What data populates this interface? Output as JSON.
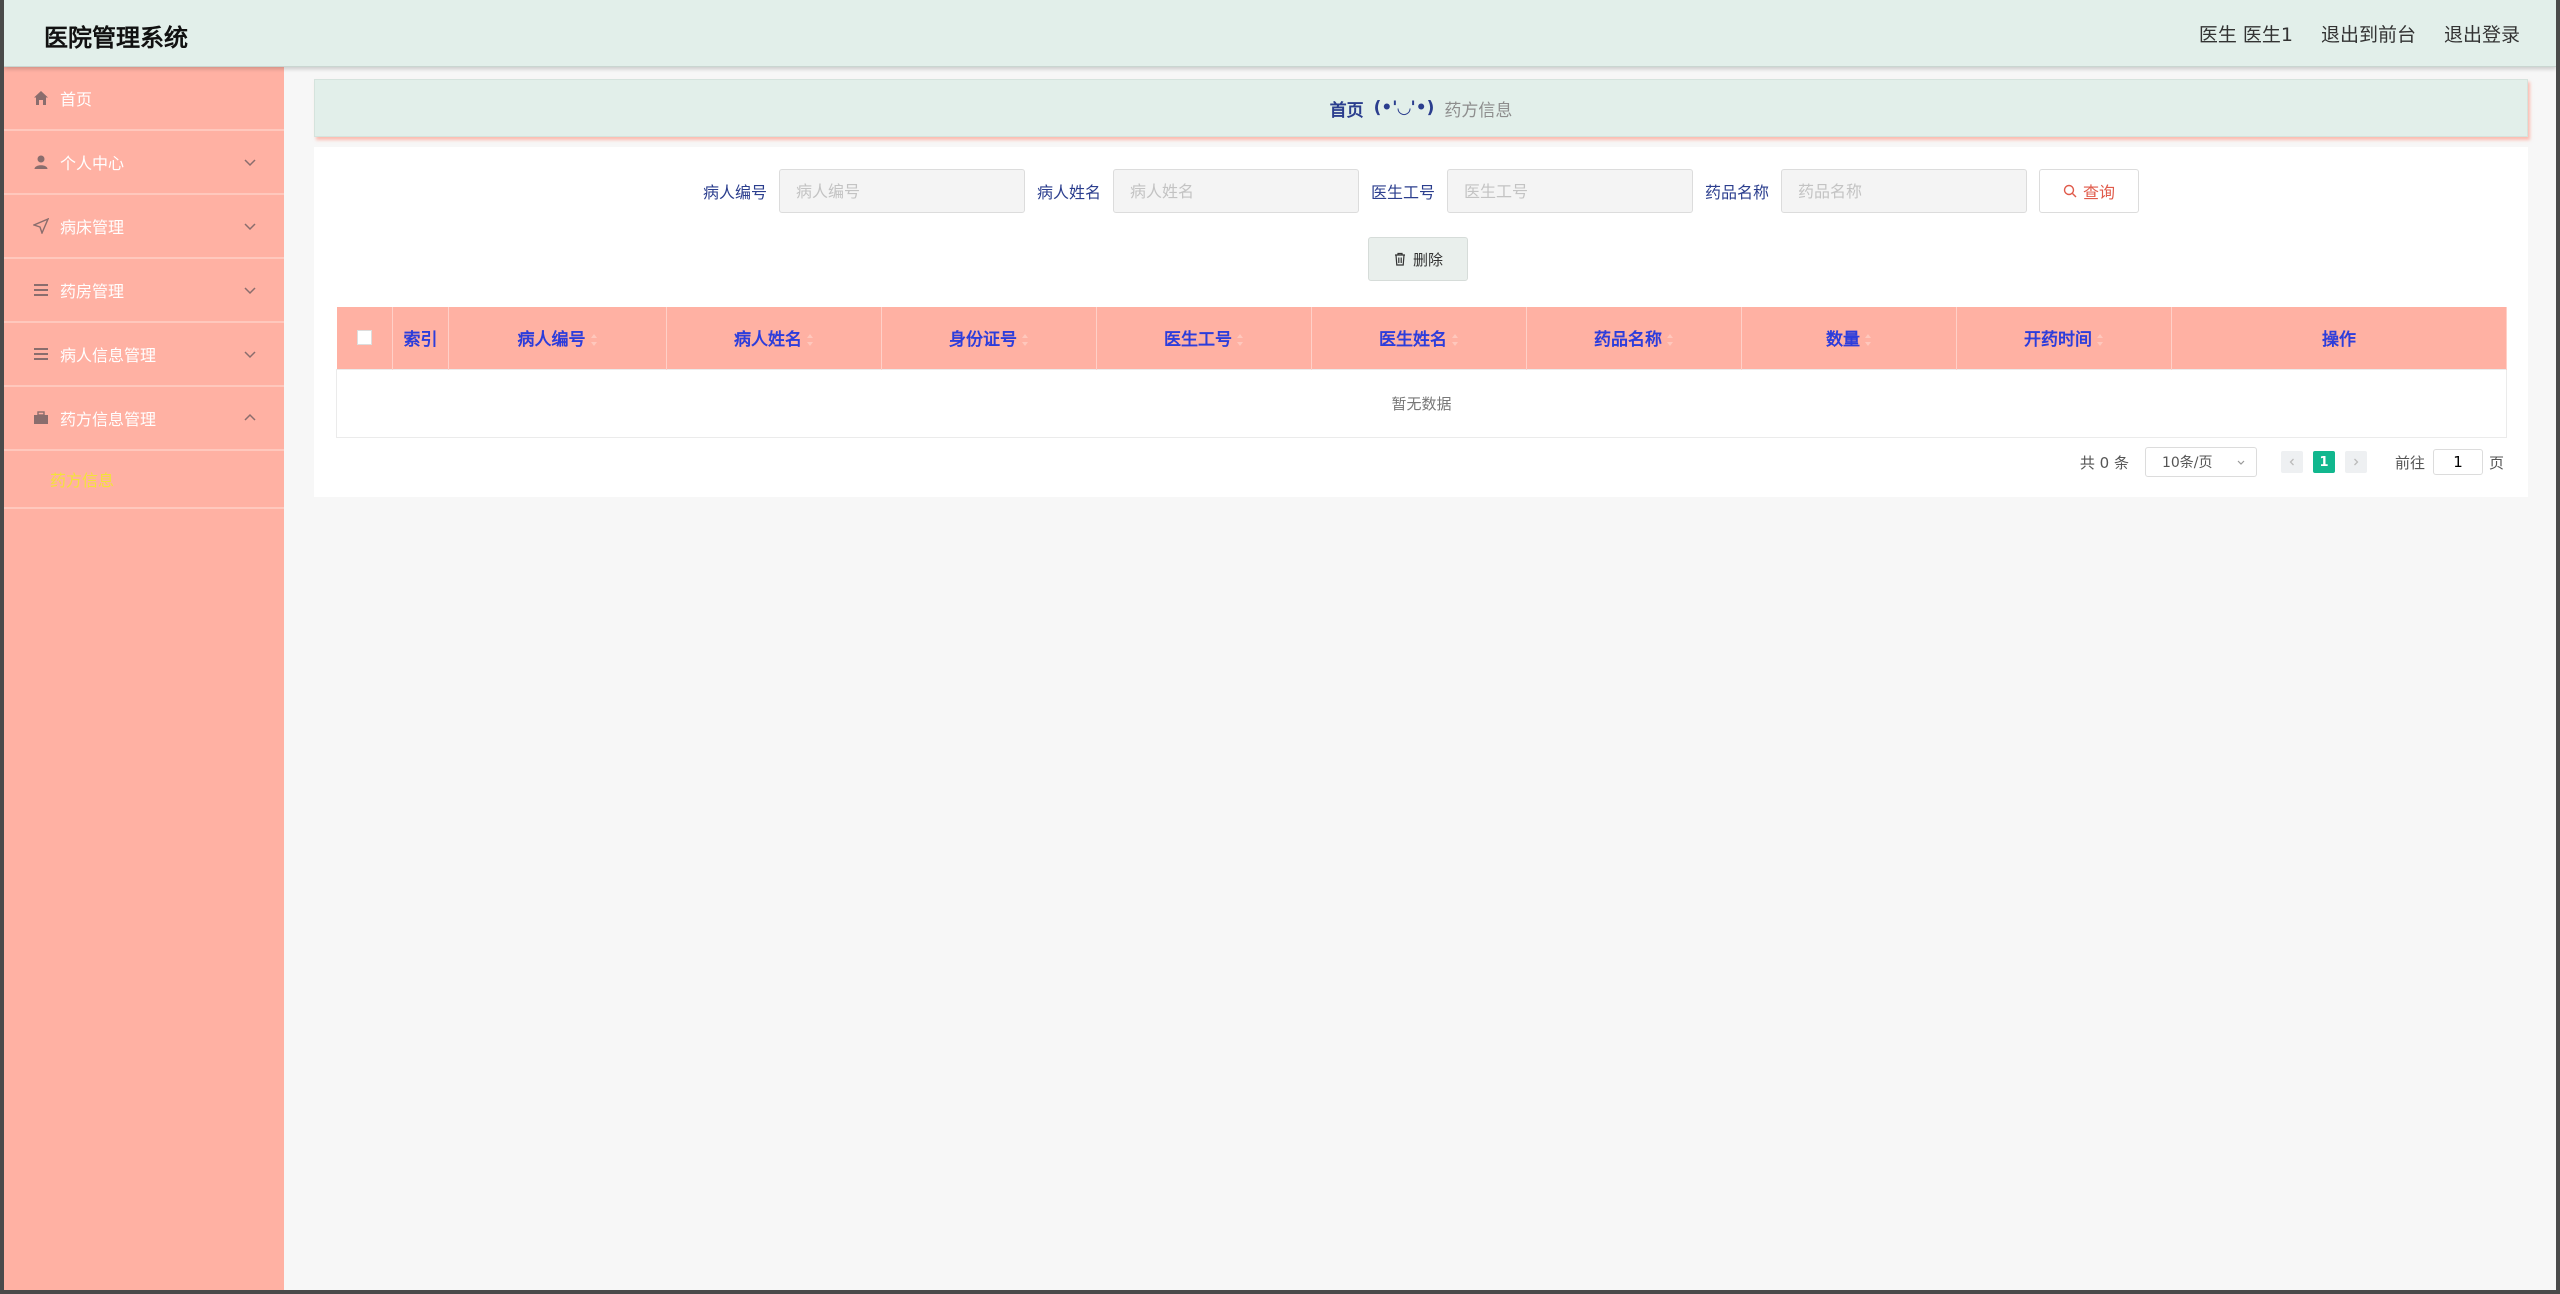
{
  "header": {
    "app_title": "医院管理系统",
    "user_label": "医生 医生1",
    "front_link": "退出到前台",
    "logout_link": "退出登录"
  },
  "sidebar": {
    "items": [
      {
        "label": "首页",
        "icon": "home-icon"
      },
      {
        "label": "个人中心",
        "icon": "user-icon"
      },
      {
        "label": "病床管理",
        "icon": "send-icon"
      },
      {
        "label": "药房管理",
        "icon": "menu-icon"
      },
      {
        "label": "病人信息管理",
        "icon": "menu-icon"
      },
      {
        "label": "药方信息管理",
        "icon": "briefcase-icon"
      }
    ],
    "submenu_active": "药方信息"
  },
  "breadcrumb": {
    "home": "首页",
    "separator": "(•'◡'•)",
    "current": "药方信息"
  },
  "search": {
    "patient_no_label": "病人编号",
    "patient_no_placeholder": "病人编号",
    "patient_name_label": "病人姓名",
    "patient_name_placeholder": "病人姓名",
    "doctor_no_label": "医生工号",
    "doctor_no_placeholder": "医生工号",
    "drug_name_label": "药品名称",
    "drug_name_placeholder": "药品名称",
    "query_label": "查询"
  },
  "actions": {
    "delete_label": "删除"
  },
  "table": {
    "columns": [
      "索引",
      "病人编号",
      "病人姓名",
      "身份证号",
      "医生工号",
      "医生姓名",
      "药品名称",
      "数量",
      "开药时间",
      "操作"
    ],
    "empty_text": "暂无数据"
  },
  "pagination": {
    "total": "共 0 条",
    "page_size": "10条/页",
    "current_page": "1",
    "goto_label": "前往",
    "goto_value": "1",
    "page_suffix": "页"
  },
  "colors": {
    "sidebar_bg": "#ffb1a3",
    "header_bg": "#e2efea",
    "table_header_text": "#2d3ddb",
    "active_submenu": "#f3e23a",
    "page_active": "#11b78e"
  }
}
